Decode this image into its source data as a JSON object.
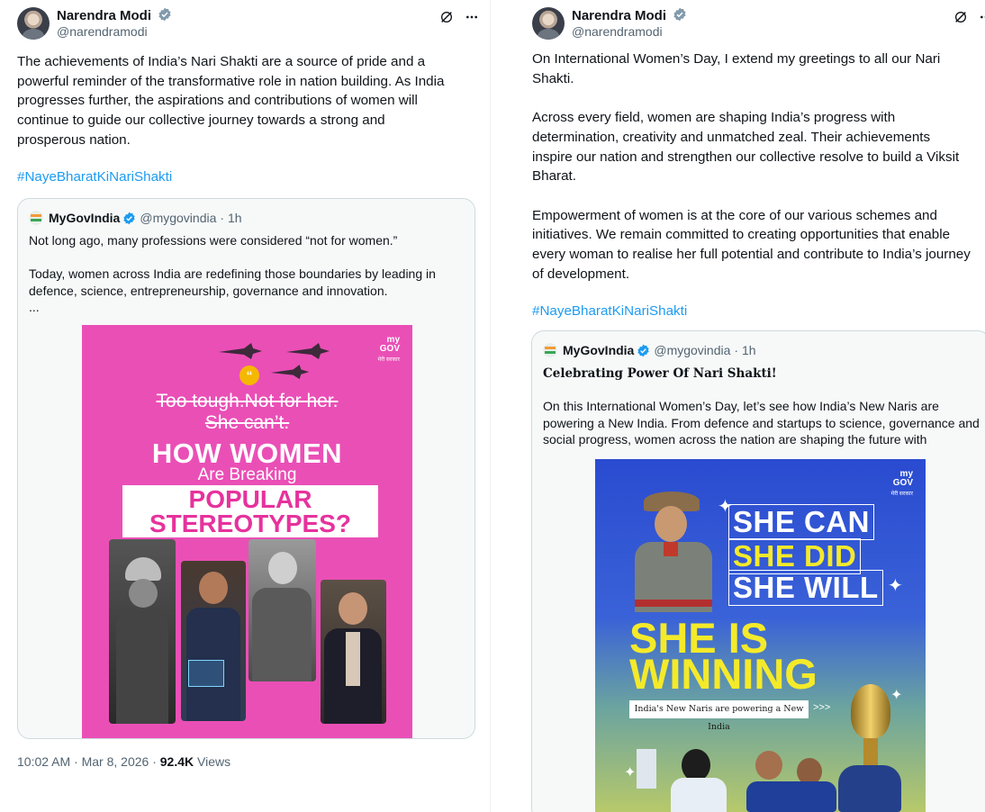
{
  "left_tweet": {
    "author": {
      "name": "Narendra Modi",
      "handle": "@narendramodi"
    },
    "text": "The achievements of India’s Nari Shakti are a source of pride and a\npowerful reminder of the transformative role in nation building. As India\nprogresses further, the aspirations and contributions of women will\ncontinue to guide our collective journey towards a strong and\nprosperous nation.",
    "hashtag": "#NayeBharatKiNariShakti",
    "quote": {
      "name": "MyGovIndia",
      "handle": "@mygovindia",
      "time": "· 1h",
      "text": "Not long ago, many professions were considered “not for women.”\n\nToday, women across India are redefining those boundaries by leading in\ndefence, science, entrepreneurship, governance and innovation.\n...",
      "poster": {
        "brand": "my\nGOV",
        "brand_sub": "मेरी सरकार",
        "strike1": "Too tough.Not for her.",
        "strike2": "She can’t.",
        "headline": "HOW WOMEN",
        "sub": "Are Breaking",
        "popular": "POPULAR",
        "stereotypes": "STEREOTYPES?",
        "quote_mark": "“"
      }
    },
    "meta": {
      "time": "10:02 AM · Mar 8, 2026 · ",
      "views_count": "92.4K",
      "views_label": " Views"
    }
  },
  "right_tweet": {
    "author": {
      "name": "Narendra Modi",
      "handle": "@narendramodi"
    },
    "text": "On International Women’s Day, I extend my greetings to all our Nari\nShakti.\n\nAcross every field, women are shaping India’s progress with\ndetermination, creativity and unmatched zeal. Their achievements\ninspire our nation and strengthen our collective resolve to build a Viksit\nBharat.\n\nEmpowerment of women is at the core of our various schemes and\ninitiatives. We remain committed to creating opportunities that enable\nevery woman to realise her full potential and contribute to India’s journey\nof development.",
    "hashtag": "#NayeBharatKiNariShakti",
    "quote": {
      "name": "MyGovIndia",
      "handle": "@mygovindia",
      "time": "· 1h",
      "bold_title": "Celebrating Power Of Nari Shakti!",
      "text": "On this International Women’s Day, let’s see how India’s New Naris are\npowering a New India. From defence and startups to science, governance and\nsocial progress, women across the nation are shaping the future with",
      "poster": {
        "brand": "my\nGOV",
        "brand_sub": "मेरी सरकार",
        "line1": "SHE CAN",
        "line2": "SHE DID",
        "line3": "SHE WILL",
        "winning1": "SHE IS",
        "winning2": "WINNING",
        "banner": "India's New Naris are powering a New India",
        "arrows": ">>>"
      }
    }
  },
  "colors": {
    "accent": "#1d9bf0",
    "pink": "#ea4fb6",
    "blue": "#2a4bd0",
    "yellow": "#f4ea2a"
  }
}
